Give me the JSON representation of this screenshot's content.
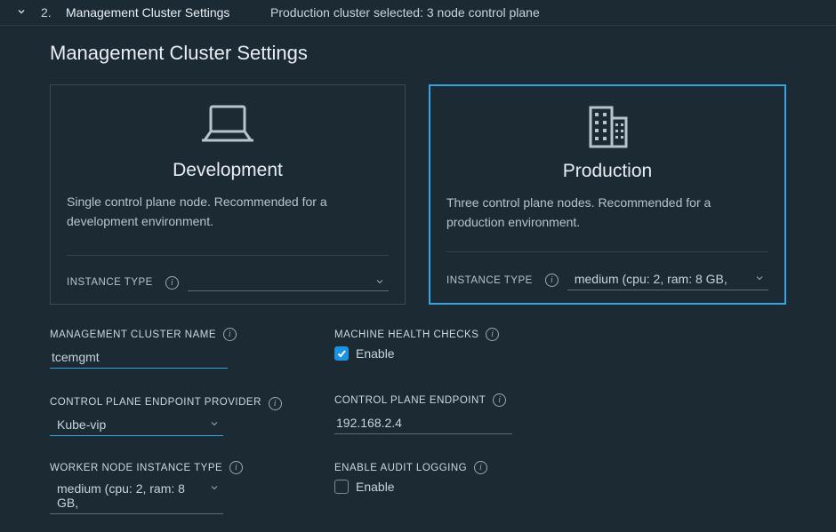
{
  "step": {
    "number": "2.",
    "title": "Management Cluster Settings",
    "summary": "Production cluster selected: 3 node control plane"
  },
  "sectionTitle": "Management Cluster Settings",
  "cards": {
    "dev": {
      "title": "Development",
      "desc": "Single control plane node. Recommended for a development environment.",
      "instanceLabel": "INSTANCE TYPE",
      "instanceValue": ""
    },
    "prod": {
      "title": "Production",
      "desc": "Three control plane nodes. Recommended for a production environment.",
      "instanceLabel": "INSTANCE TYPE",
      "instanceValue": "medium (cpu: 2, ram: 8 GB,"
    }
  },
  "form": {
    "clusterNameLabel": "MANAGEMENT CLUSTER NAME",
    "clusterNameValue": "tcemgmt",
    "mhcLabel": "MACHINE HEALTH CHECKS",
    "mhcEnable": "Enable",
    "cpepProviderLabel": "CONTROL PLANE ENDPOINT PROVIDER",
    "cpepProviderValue": "Kube-vip",
    "cpeLabel": "CONTROL PLANE ENDPOINT",
    "cpeValue": "192.168.2.4",
    "workerLabel": "WORKER NODE INSTANCE TYPE",
    "workerValue": "medium (cpu: 2, ram: 8 GB,",
    "auditLabel": "ENABLE AUDIT LOGGING",
    "auditEnable": "Enable"
  }
}
